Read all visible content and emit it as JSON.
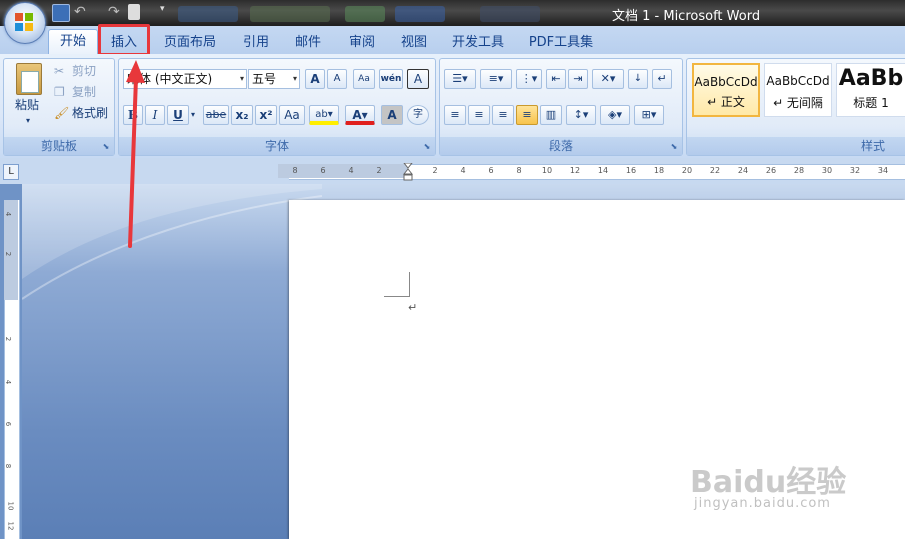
{
  "window": {
    "title": "文档 1 - Microsoft Word"
  },
  "tabs": [
    {
      "label": "开始",
      "active": true
    },
    {
      "label": "插入",
      "highlighted": true
    },
    {
      "label": "页面布局"
    },
    {
      "label": "引用"
    },
    {
      "label": "邮件"
    },
    {
      "label": "审阅"
    },
    {
      "label": "视图"
    },
    {
      "label": "开发工具"
    },
    {
      "label": "PDF工具集"
    }
  ],
  "clipboard": {
    "paste": "粘贴",
    "cut": "剪切",
    "copy": "复制",
    "format_painter": "格式刷",
    "group_label": "剪贴板"
  },
  "font": {
    "font_name": "宋体 (中文正文)",
    "font_size": "五号",
    "group_label": "字体",
    "bold": "B",
    "italic": "I",
    "underline": "U",
    "strike": "abe",
    "subscript": "x₂",
    "superscript": "x²",
    "change_case": "Aa",
    "grow": "A",
    "shrink": "A",
    "phonetic": "wén",
    "char_border": "A",
    "char_shading": "A",
    "enclose": "字"
  },
  "paragraph": {
    "group_label": "段落"
  },
  "styles": {
    "items": [
      {
        "sample": "AaBbCcDd",
        "name": "↵ 正文",
        "selected": true
      },
      {
        "sample": "AaBbCcDd",
        "name": "↵ 无间隔"
      },
      {
        "sample": "AaBb",
        "name": "标题 1"
      }
    ],
    "group_label": "样式"
  },
  "ruler": {
    "ticks": [
      "8",
      "6",
      "4",
      "2",
      "2",
      "4",
      "6",
      "8",
      "10",
      "12",
      "14",
      "16",
      "18",
      "20",
      "22",
      "24",
      "26",
      "28",
      "30",
      "32",
      "34"
    ]
  },
  "vruler": {
    "ticks": [
      "4",
      "2",
      "2",
      "4",
      "6",
      "8",
      "10",
      "12"
    ]
  },
  "document": {
    "paragraph_mark": "↵"
  },
  "watermark": {
    "logo": "Baidu经验",
    "url": "jingyan.baidu.com"
  },
  "colors": {
    "highlight_annotation": "#e8373b",
    "ribbon_text": "#15428b"
  }
}
